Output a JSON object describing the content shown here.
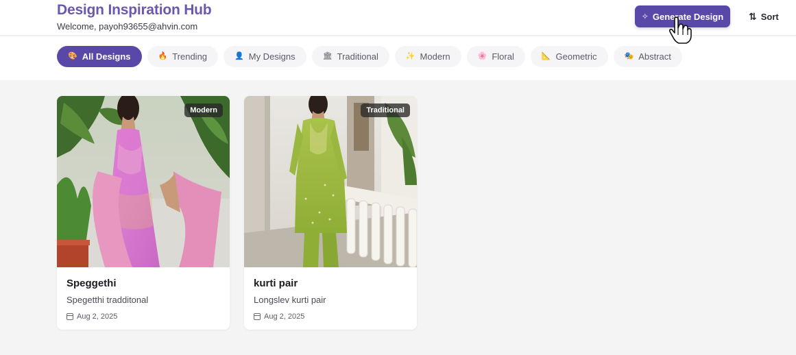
{
  "header": {
    "title": "Design Inspiration Hub",
    "welcome": "Welcome, payoh93655@ahvin.com",
    "generate_label": "Generate Design",
    "generate_icon": "magic-wand-icon",
    "sort_label": "Sort",
    "sort_icon": "sort-arrows-icon"
  },
  "colors": {
    "accent": "#5a48a8",
    "title": "#6a58b0",
    "background": "#f4f4f5"
  },
  "filters": [
    {
      "label": "All Designs",
      "icon": "🎨",
      "active": true
    },
    {
      "label": "Trending",
      "icon": "🔥",
      "active": false
    },
    {
      "label": "My Designs",
      "icon": "👤",
      "active": false
    },
    {
      "label": "Traditional",
      "icon": "🏛",
      "active": false
    },
    {
      "label": "Modern",
      "icon": "✨",
      "active": false
    },
    {
      "label": "Floral",
      "icon": "🌸",
      "active": false
    },
    {
      "label": "Geometric",
      "icon": "📐",
      "active": false
    },
    {
      "label": "Abstract",
      "icon": "🎭",
      "active": false
    }
  ],
  "designs": [
    {
      "badge": "Modern",
      "title": "Speggethi",
      "description": "Spegetthi tradditonal",
      "date": "Aug 2, 2025"
    },
    {
      "badge": "Traditional",
      "title": "kurti pair",
      "description": "Longslev kurti pair",
      "date": "Aug 2, 2025"
    }
  ]
}
